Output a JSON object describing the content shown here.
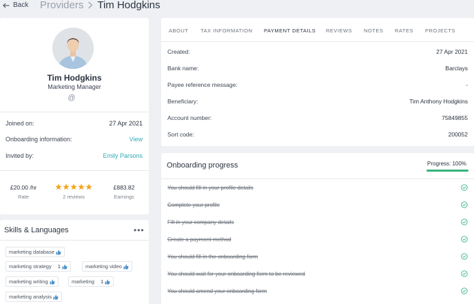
{
  "header": {
    "back_label": "Back",
    "breadcrumb_parent": "Providers",
    "breadcrumb_current": "Tim Hodgkins"
  },
  "profile": {
    "name": "Tim Hodgkins",
    "role": "Marketing Manager",
    "email_symbol": "@",
    "joined_label": "Joined on:",
    "joined_value": "27 Apr 2021",
    "onboarding_label": "Onboarding information:",
    "onboarding_link": "View",
    "invited_label": "Invited by:",
    "invited_value": "Emily Parsons",
    "rate_value": "£20.00 /hr",
    "rate_label": "Rate",
    "rating_stars": 5,
    "reviews_label": "2 reviews",
    "earnings_value": "£883.82",
    "earnings_label": "Earnings"
  },
  "skills": {
    "title": "Skills & Languages",
    "more": "•••",
    "tags": [
      {
        "label": "marketing database",
        "count": ""
      },
      {
        "label": "marketing strategy",
        "count": "1"
      },
      {
        "label": "marketing video",
        "count": ""
      },
      {
        "label": "marketing writing",
        "count": ""
      },
      {
        "label": "marketing",
        "count": "1"
      },
      {
        "label": "marketing analysis",
        "count": ""
      }
    ]
  },
  "tabs": [
    "ABOUT",
    "TAX INFORMATION",
    "PAYMENT DETAILS",
    "REVIEWS",
    "NOTES",
    "RATES",
    "PROJECTS"
  ],
  "active_tab": "PAYMENT DETAILS",
  "payment": {
    "rows": [
      {
        "label": "Created:",
        "value": "27 Apr 2021"
      },
      {
        "label": "Bank name:",
        "value": "Barclays"
      },
      {
        "label": "Payee reference message:",
        "value": "-"
      },
      {
        "label": "Beneficiary:",
        "value": "Tim Anthony Hodgkins"
      },
      {
        "label": "Account number:",
        "value": "75849855"
      },
      {
        "label": "Sort code:",
        "value": "200052"
      }
    ]
  },
  "onboarding": {
    "title": "Onboarding progress",
    "progress_label": "Progress: 100%",
    "progress_percent": 100,
    "items": [
      "You should fill in your profile details",
      "Complete your profile",
      "Fill in your company details",
      "Create a payment method",
      "You should fill in the onboarding form",
      "You should wait for your onboarding form to be reviewed",
      "You should amend your onboarding form"
    ]
  },
  "colors": {
    "accent_link": "#34a8b8",
    "star": "#f5a623",
    "success": "#36b37e",
    "page_bg": "#eef0f3"
  }
}
